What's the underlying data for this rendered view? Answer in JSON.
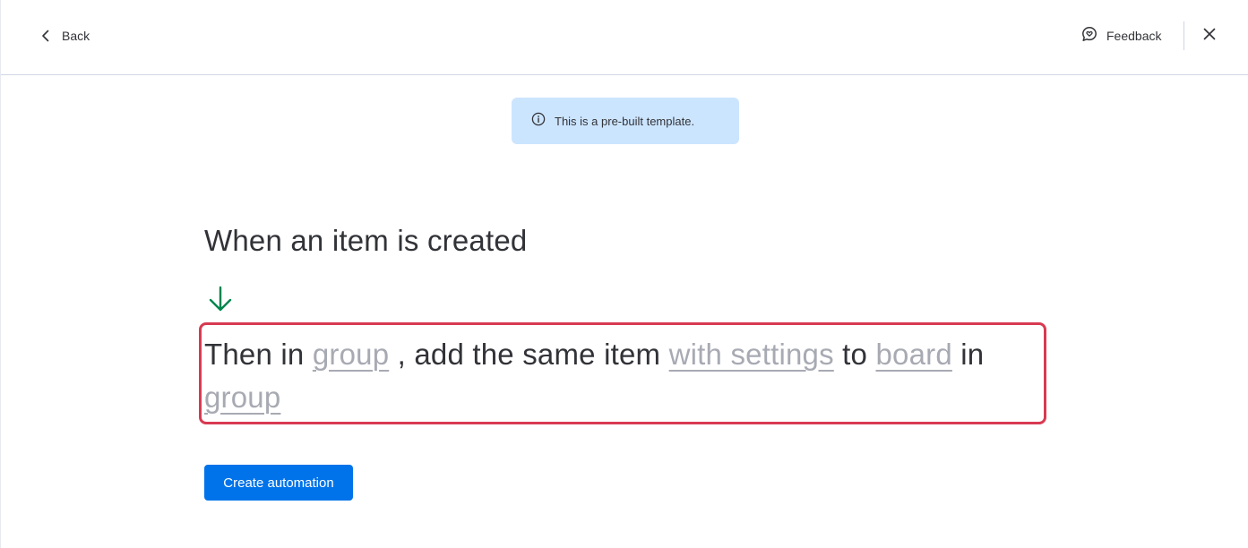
{
  "header": {
    "back_label": "Back",
    "feedback_label": "Feedback"
  },
  "banner": {
    "text": "This is a pre-built template."
  },
  "recipe": {
    "trigger": "When an item is created",
    "action": {
      "t1": "Then in ",
      "field_group_1": "group",
      "t2": " , add the same item ",
      "field_settings": "with settings",
      "t3": " to ",
      "field_board": "board",
      "t4": " in ",
      "field_group_2": "group"
    }
  },
  "primary_button": {
    "label": "Create automation"
  },
  "icons": {
    "back": "chevron-left-icon",
    "feedback": "feedback-chat-icon",
    "close": "close-icon",
    "info": "info-icon",
    "arrow": "arrow-down-icon"
  },
  "colors": {
    "primary": "#0073ea",
    "banner_bg": "#cce5ff",
    "highlight_border": "#d83a52",
    "arrow": "#00854d",
    "placeholder_field": "#a8aab3"
  }
}
